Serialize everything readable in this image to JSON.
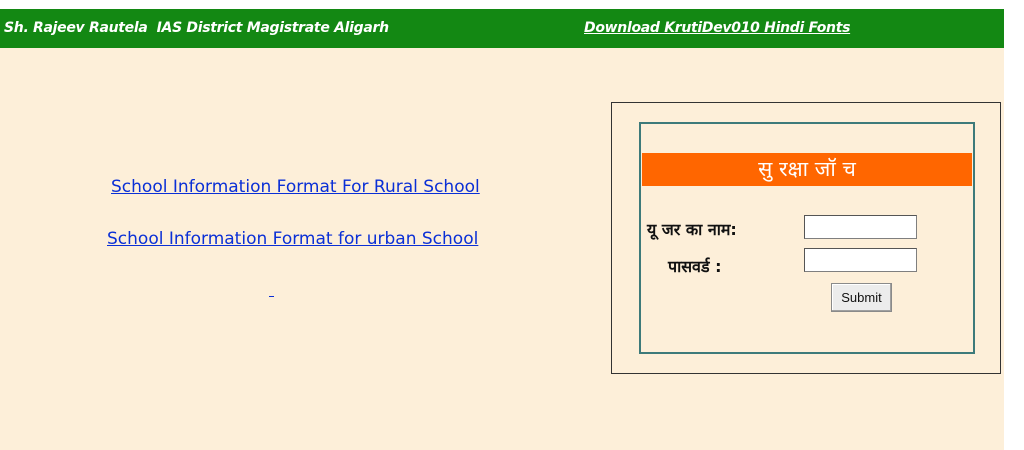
{
  "header": {
    "title": "Sh. Rajeev Rautela  IAS District Magistrate Aligarh",
    "download_link": "Download KrutiDev010 Hindi Fonts"
  },
  "main": {
    "links": [
      "School Information Format For Rural School",
      "School Information Format for urban School"
    ]
  },
  "login": {
    "title": "सु रक्षा जॉ च",
    "username_label": "यू जर का नाम:",
    "password_label": "पासवर्ड :",
    "username_value": "",
    "password_value": "",
    "submit_label": "Submit"
  },
  "colors": {
    "header_bg": "#138813",
    "page_bg": "#fdefd9",
    "link": "#0a2fd6",
    "login_header_bg": "#ff6600",
    "login_border": "#3d7a7a"
  }
}
